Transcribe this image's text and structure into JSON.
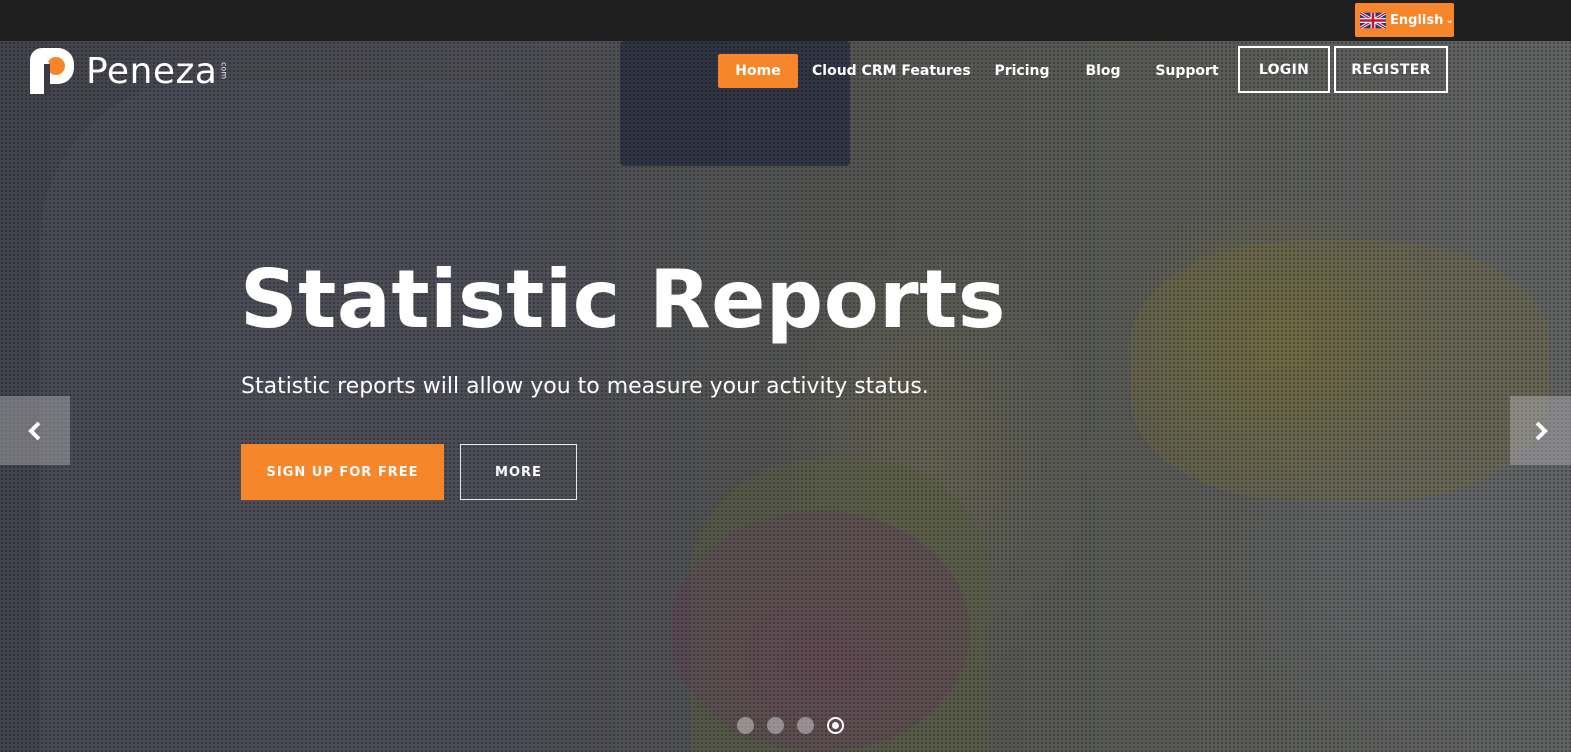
{
  "language": {
    "label": "English",
    "flag_icon": "uk-flag-icon"
  },
  "logo": {
    "text": "Peneza",
    "suffix": "com"
  },
  "nav": {
    "items": [
      {
        "label": "Home",
        "active": true
      },
      {
        "label": "Cloud CRM Features"
      },
      {
        "label": "Pricing"
      },
      {
        "label": "Blog"
      },
      {
        "label": "Support"
      }
    ],
    "login_label": "LOGIN",
    "register_label": "REGISTER"
  },
  "hero": {
    "title": "Statistic Reports",
    "subtitle": "Statistic reports will allow you to measure your activity status.",
    "signup_label": "SIGN UP FOR FREE",
    "more_label": "MORE",
    "prev_icon": "chevron-left-icon",
    "next_icon": "chevron-right-icon",
    "slides_count": 4,
    "active_slide": 4
  },
  "colors": {
    "accent": "#f7852a",
    "topbar": "#1f1f1f"
  }
}
